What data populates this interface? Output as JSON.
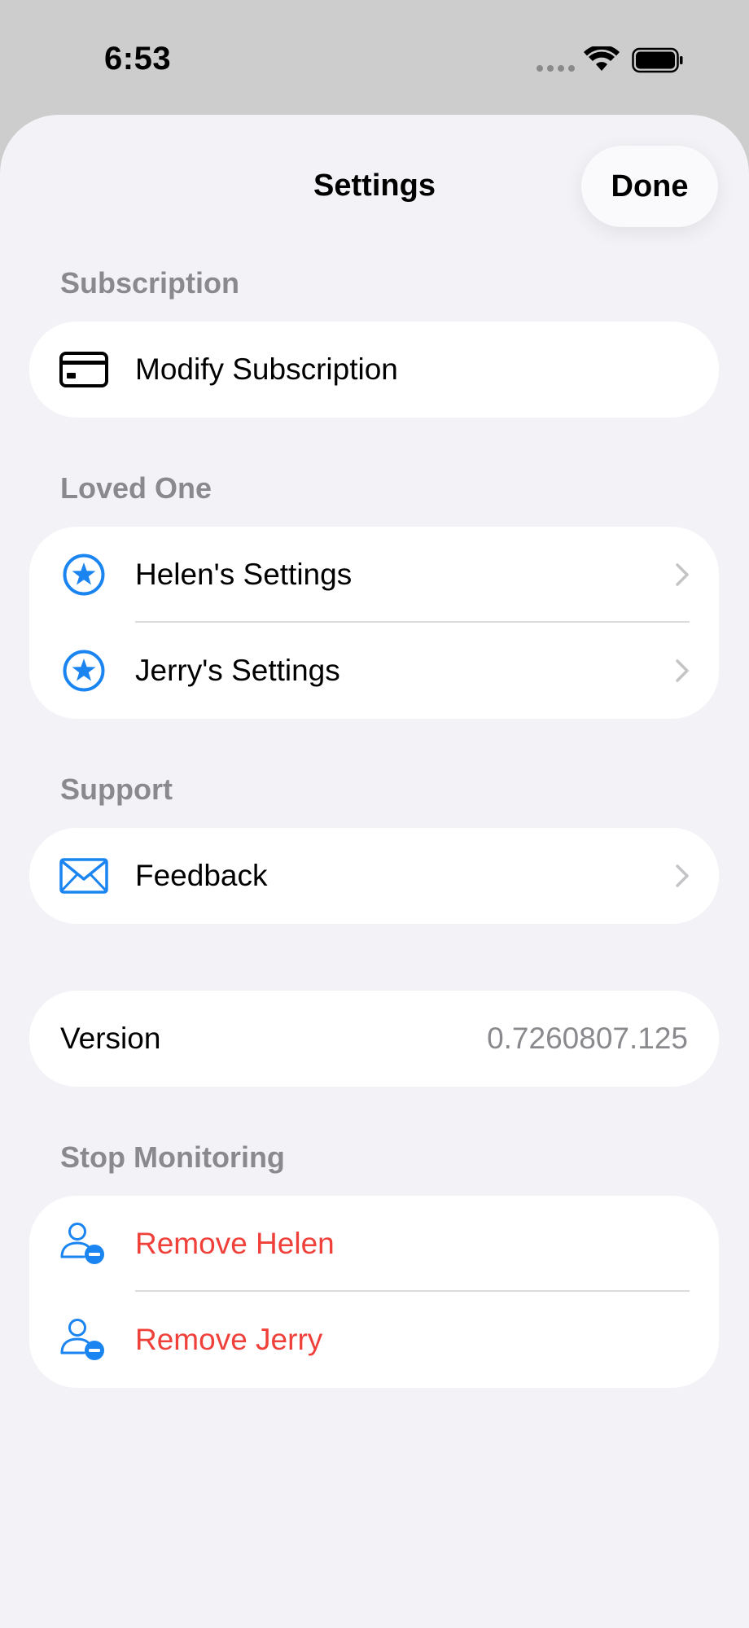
{
  "status_bar": {
    "time": "6:53"
  },
  "nav": {
    "title": "Settings",
    "done_label": "Done"
  },
  "sections": {
    "subscription": {
      "header": "Subscription",
      "modify_label": "Modify Subscription"
    },
    "loved_one": {
      "header": "Loved One",
      "items": [
        {
          "label": "Helen's Settings",
          "icon": "star-circle-icon"
        },
        {
          "label": "Jerry's Settings",
          "icon": "star-circle-icon"
        }
      ]
    },
    "support": {
      "header": "Support",
      "feedback_label": "Feedback"
    },
    "version": {
      "label": "Version",
      "value": "0.7260807.125"
    },
    "stop_monitoring": {
      "header": "Stop Monitoring",
      "items": [
        {
          "label": "Remove Helen",
          "icon": "person-remove-icon"
        },
        {
          "label": "Remove Jerry",
          "icon": "person-remove-icon"
        }
      ]
    }
  },
  "colors": {
    "accent": "#1a84f0",
    "danger": "#f0403a",
    "secondary_text": "#8a8a8e",
    "sheet_background": "#f2f2f7"
  }
}
